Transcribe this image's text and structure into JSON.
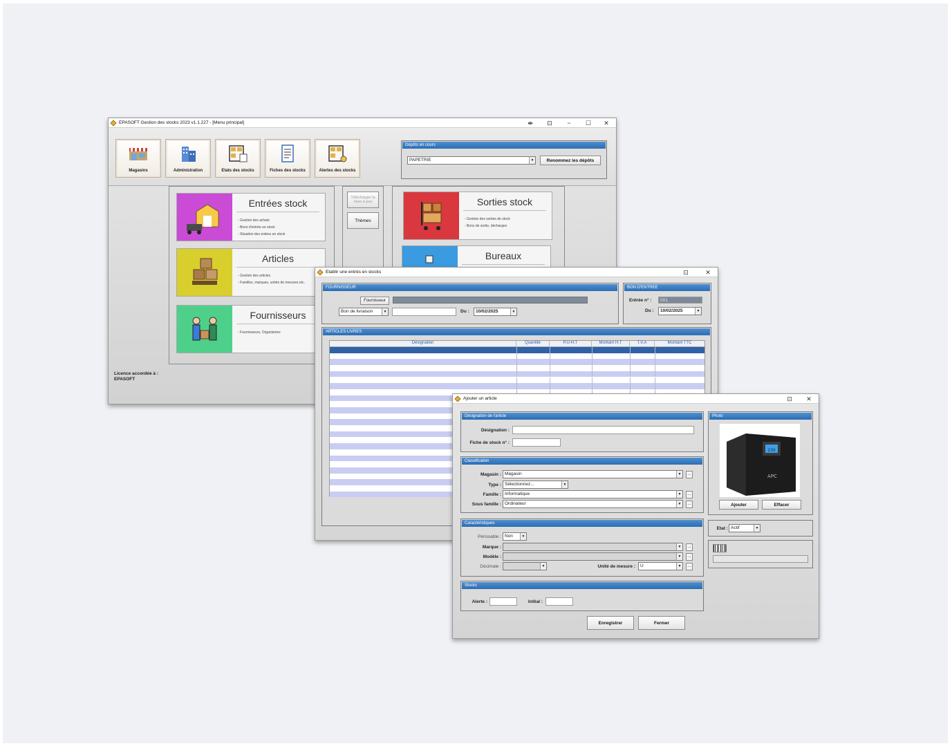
{
  "main_window": {
    "title": "EPASOFT Gestion des stocks 2023 v1.1.227 - [Menu principal]",
    "toolbar": [
      "Magasins",
      "Administration",
      "Etats des stocks",
      "Fiches des stocks",
      "Alertes des stocks"
    ],
    "depots": {
      "header": "Dépôts en cours",
      "selected": "PAPETRIE",
      "rename_button": "Renommez les dépôts"
    },
    "cards": {
      "entrees": {
        "title": "Entrées stock",
        "desc": "- Gestion des achats\n- Bons d'entrée en stock\n- Situation des entées en stock"
      },
      "articles": {
        "title": "Articles",
        "desc": "- Gestion des articles\n- Familles, marques, unités de mesures etc."
      },
      "fournisseurs": {
        "title": "Fournisseurs",
        "desc": "- Fournisseurs, Organismes"
      },
      "sorties": {
        "title": "Sorties stock",
        "desc": "- Gestion des sorties de stock\n- Bons de sortie, décharges"
      },
      "bureaux": {
        "title": "Bureaux"
      }
    },
    "middle_buttons": {
      "update": "Télécharger la mise à jour",
      "themes": "Thèmes"
    },
    "license": {
      "label": "Licence accordée à :",
      "owner": "EPASOFT"
    }
  },
  "entry_window": {
    "title": "Etablir une entrés en stocks",
    "fournisseur": {
      "header": "FOURNISSEUR",
      "button": "Fournisseur",
      "doc_type": "Bon de livraison",
      "du_label": "Du :",
      "date": "10/02/2025"
    },
    "bon": {
      "header": "BON D'ENTREE",
      "entree_label": "Entrée n° :",
      "entree_value": "001",
      "du_label": "Du :",
      "date": "10/02/2025"
    },
    "articles": {
      "header": "ARTICLES LIVRES",
      "columns": [
        "Désignation",
        "Quantité",
        "P.U-H.T",
        "Montant H.T",
        "T.V.A",
        "Montant TTC"
      ]
    }
  },
  "add_window": {
    "title": "Ajouter un article",
    "designation": {
      "header": "Désignation de l'article",
      "designation_label": "Désignation :",
      "fiche_label": "Fiche de stock n° :"
    },
    "classification": {
      "header": "Classification",
      "magasin_label": "Magasin :",
      "magasin_value": "Magasin",
      "type_label": "Type :",
      "type_value": "Sélectionnez...",
      "famille_label": "Famille :",
      "famille_value": "Informatique",
      "sous_famille_label": "Sous famille :",
      "sous_famille_value": "Ordinateur"
    },
    "caracteristiques": {
      "header": "Caractéristiques",
      "perissable_label": "Périssable :",
      "perissable_value": "Non",
      "marque_label": "Marque :",
      "modele_label": "Modèle :",
      "decimale_label": "Décimale :",
      "unite_label": "Unité de mesure :",
      "unite_value": "U"
    },
    "stocks": {
      "header": "Stocks",
      "alerte_label": "Alerte :",
      "initial_label": "Initial :"
    },
    "photo": {
      "header": "Photo",
      "ajouter": "Ajouter",
      "effacer": "Effacer",
      "ups_brand": "APC",
      "ups_display": "230"
    },
    "etat": {
      "label": "Etat :",
      "value": "Actif"
    },
    "buttons": {
      "save": "Enregistrer",
      "close": "Fermer"
    }
  }
}
